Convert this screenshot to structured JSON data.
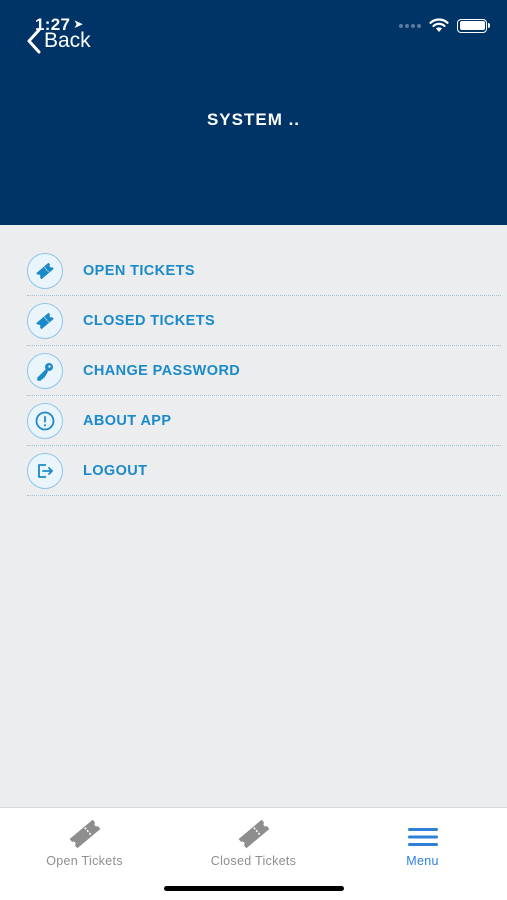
{
  "status_bar": {
    "time": "1:27"
  },
  "header": {
    "back_label": "Back",
    "title": "SYSTEM .."
  },
  "menu": {
    "items": [
      {
        "label": "OPEN TICKETS",
        "icon": "ticket-icon"
      },
      {
        "label": "CLOSED TICKETS",
        "icon": "ticket-icon"
      },
      {
        "label": "CHANGE PASSWORD",
        "icon": "key-icon"
      },
      {
        "label": "ABOUT APP",
        "icon": "info-icon"
      },
      {
        "label": "LOGOUT",
        "icon": "logout-icon"
      }
    ]
  },
  "tabbar": {
    "tabs": [
      {
        "label": "Open Tickets",
        "icon": "ticket-icon",
        "active": false
      },
      {
        "label": "Closed Tickets",
        "icon": "ticket-icon",
        "active": false
      },
      {
        "label": "Menu",
        "icon": "hamburger-icon",
        "active": true
      }
    ]
  },
  "colors": {
    "header_bg": "#003366",
    "menu_text": "#1a8ac9",
    "tab_active": "#2f80d9",
    "tab_inactive": "#8e8e8e",
    "page_bg": "#ecedef"
  }
}
